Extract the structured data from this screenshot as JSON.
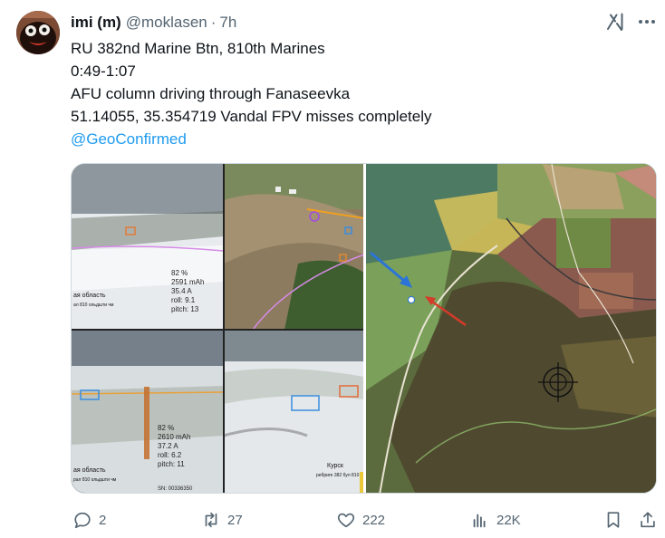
{
  "author": {
    "display_name": "imi (m)",
    "handle": "@moklasen",
    "separator": "·",
    "time": "7h"
  },
  "tweet": {
    "lines": [
      "RU 382nd Marine Btn, 810th Marines",
      "0:49-1:07",
      "AFU column driving through Fanaseevka",
      "51.14055, 35.354719 Vandal FPV misses completely"
    ],
    "mention": "@GeoConfirmed"
  },
  "media": {
    "overlay_panels": {
      "top_left": {
        "stats": [
          "82 %",
          "2591 mAh",
          "35.4 A",
          "roll: 9.1",
          "pitch: 13"
        ],
        "region": "ая область",
        "caption": "ал 810 ольдшти чм"
      },
      "bottom_left": {
        "stats": [
          "82 %",
          "2610 mAh",
          "37.2 A",
          "roll: 6.2",
          "pitch: 11"
        ],
        "region": "ая область",
        "caption": "рал 810 ольдшти чм",
        "id": "SN: 00336350"
      },
      "bottom_right": {
        "region": "Курск",
        "caption": "ребриге 382 бул 810"
      }
    }
  },
  "actions": {
    "replies": "2",
    "reposts": "27",
    "likes": "222",
    "views": "22K"
  },
  "icons": {
    "grok": "grok-icon",
    "more": "more-icon",
    "reply": "reply-icon",
    "repost": "repost-icon",
    "like": "like-icon",
    "views": "views-icon",
    "bookmark": "bookmark-icon",
    "share": "share-icon"
  },
  "colors": {
    "text": "#0f1419",
    "secondary": "#536471",
    "link": "#1d9bf0"
  }
}
